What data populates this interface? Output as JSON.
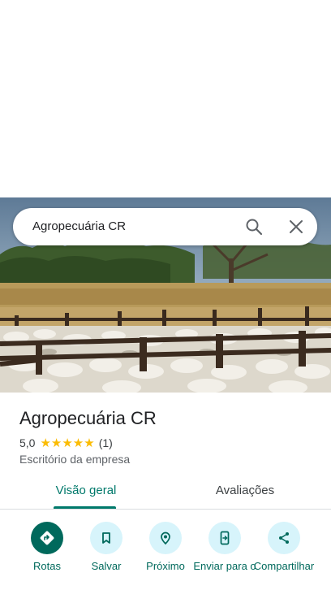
{
  "search": {
    "query": "Agropecuária CR"
  },
  "place": {
    "name": "Agropecuária CR",
    "rating": "5,0",
    "stars": "★★★★★",
    "review_count": "(1)",
    "category": "Escritório da empresa"
  },
  "tabs": [
    {
      "label": "Visão geral",
      "active": true
    },
    {
      "label": "Avaliações",
      "active": false
    }
  ],
  "actions": [
    {
      "label": "Rotas",
      "icon": "directions-icon"
    },
    {
      "label": "Salvar",
      "icon": "bookmark-icon"
    },
    {
      "label": "Próximo",
      "icon": "nearby-icon"
    },
    {
      "label": "Enviar para o",
      "icon": "send-to-phone-icon"
    },
    {
      "label": "Compartilhar",
      "icon": "share-icon"
    }
  ],
  "colors": {
    "accent": "#00796b",
    "action_primary": "#00695c",
    "action_bg": "#d7f4fb",
    "star": "#fbbc04"
  }
}
